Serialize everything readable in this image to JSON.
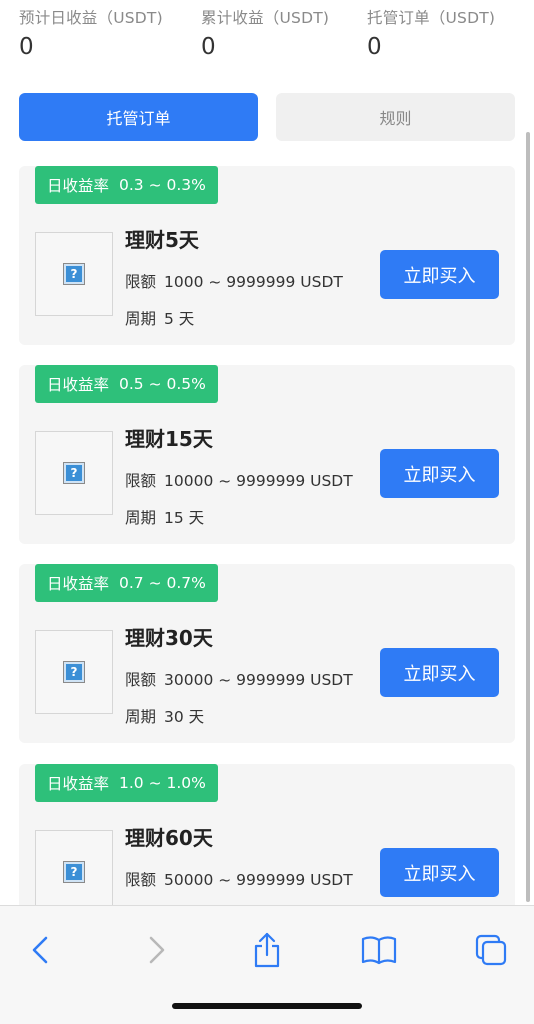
{
  "stats": [
    {
      "label": "预计日收益（USDT)",
      "value": "0"
    },
    {
      "label": "累计收益（USDT)",
      "value": "0"
    },
    {
      "label": "托管订单（USDT)",
      "value": "0"
    }
  ],
  "tabs": {
    "active": "托管订单",
    "inactive": "规则"
  },
  "products": [
    {
      "rate_label": "日收益率",
      "rate": "0.3 ~ 0.3%",
      "title": "理财5天",
      "limit_label": "限额",
      "limit": "1000 ~ 9999999 USDT",
      "period_label": "周期",
      "period": "5 天",
      "buy_label": "立即买入",
      "image_placeholder": "?"
    },
    {
      "rate_label": "日收益率",
      "rate": "0.5 ~ 0.5%",
      "title": "理财15天",
      "limit_label": "限额",
      "limit": "10000 ~ 9999999 USDT",
      "period_label": "周期",
      "period": "15 天",
      "buy_label": "立即买入",
      "image_placeholder": "?"
    },
    {
      "rate_label": "日收益率",
      "rate": "0.7 ~ 0.7%",
      "title": "理财30天",
      "limit_label": "限额",
      "limit": "30000 ~ 9999999 USDT",
      "period_label": "周期",
      "period": "30 天",
      "buy_label": "立即买入",
      "image_placeholder": "?"
    },
    {
      "rate_label": "日收益率",
      "rate": "1.0 ~ 1.0%",
      "title": "理财60天",
      "limit_label": "限额",
      "limit": "50000 ~ 9999999 USDT",
      "period_label": "周期",
      "period": "",
      "buy_label": "立即买入",
      "image_placeholder": "?"
    }
  ],
  "toolbar": {
    "icons": [
      "back-icon",
      "forward-icon",
      "share-icon",
      "bookmarks-icon",
      "tabs-icon"
    ]
  },
  "colors": {
    "primary": "#2f7bf5",
    "badge": "#2ec07a",
    "card_bg": "#f5f5f5"
  }
}
